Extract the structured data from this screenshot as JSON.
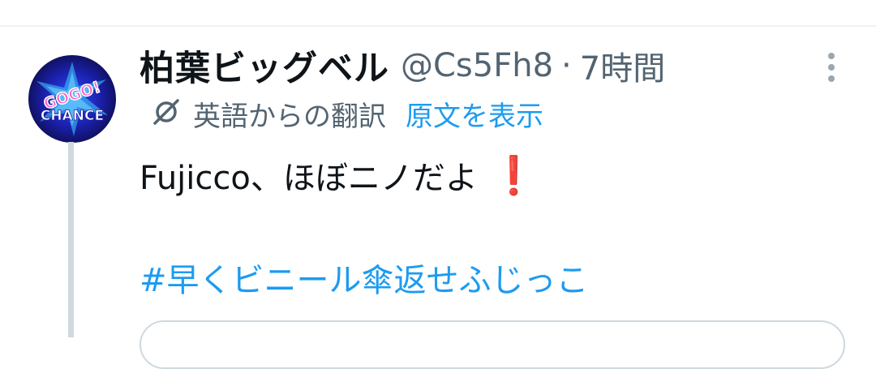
{
  "tweet": {
    "display_name": "柏葉ビッグベル",
    "handle": "@Cs5Fh8",
    "separator": "·",
    "time": "7時間",
    "translation_label": "英語からの翻訳",
    "show_original_label": "原文を表示",
    "text": "Fujicco、ほぼニノだよ",
    "emoji": "❗",
    "hashtag": "#早くビニール傘返せふじっこ",
    "avatar_text_top": "GOGO!",
    "avatar_text_bottom": "CHANCE"
  },
  "icons": {
    "translate": "translate-slash-icon",
    "more": "more-vertical-icon"
  },
  "colors": {
    "link": "#1d9bf0",
    "secondary_text": "#536471",
    "primary_text": "#0f1419",
    "thread_line": "#cfd9de",
    "exclaim": "#e0245e"
  }
}
